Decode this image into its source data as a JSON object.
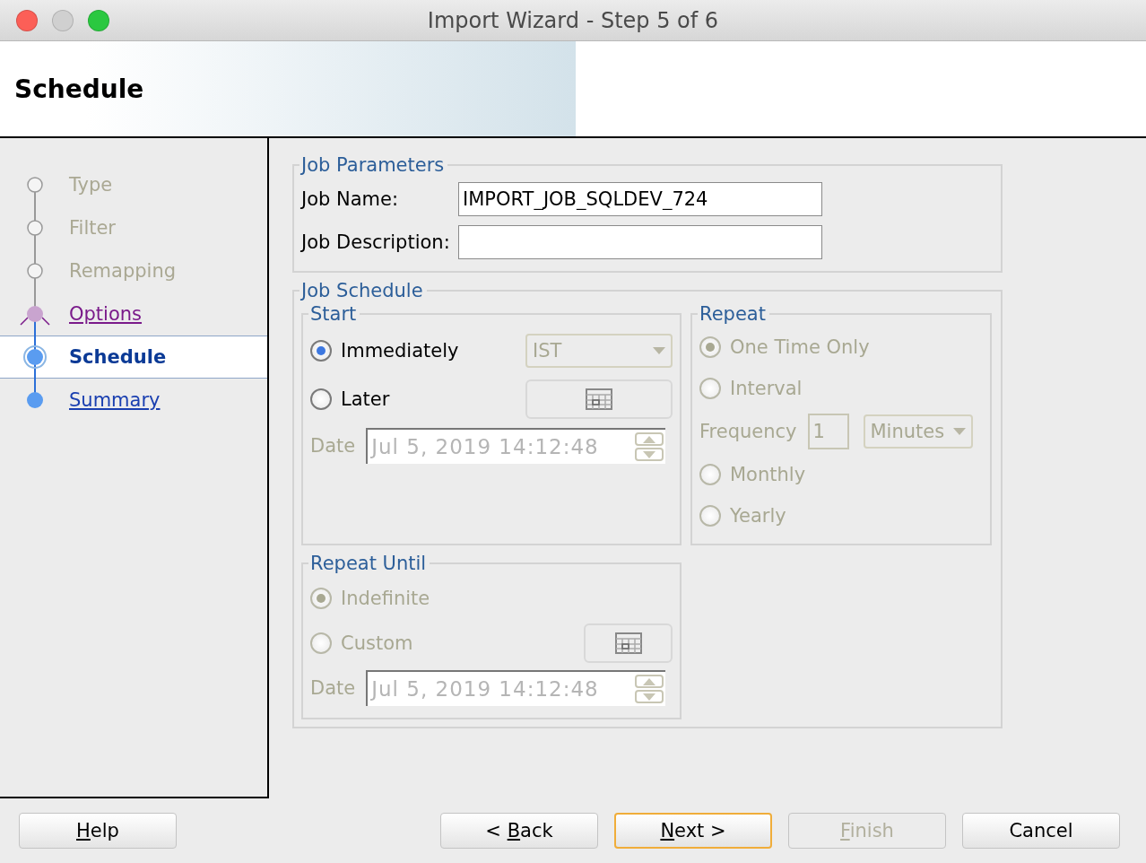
{
  "window": {
    "title": "Import Wizard - Step 5 of 6"
  },
  "header": {
    "title": "Schedule"
  },
  "steps": [
    {
      "label": "Type",
      "kind": "done",
      "selected": false
    },
    {
      "label": "Filter",
      "kind": "done",
      "selected": false
    },
    {
      "label": "Remapping",
      "kind": "done",
      "selected": false
    },
    {
      "label": "Options",
      "kind": "visited",
      "selected": false
    },
    {
      "label": "Schedule",
      "kind": "current",
      "selected": true
    },
    {
      "label": "Summary",
      "kind": "link",
      "selected": false
    }
  ],
  "job_parameters": {
    "title": "Job Parameters",
    "fields": [
      {
        "label": "Job Name:",
        "value": "IMPORT_JOB_SQLDEV_724"
      },
      {
        "label": "Job Description:"
      }
    ]
  },
  "job_schedule": {
    "title": "Job Schedule",
    "start": {
      "title": "Start",
      "options": [
        {
          "label": "Immediately",
          "selected": true,
          "disabled": false
        },
        {
          "label": "Later",
          "selected": false,
          "disabled": false
        }
      ],
      "timezone": {
        "value": "IST",
        "disabled": true
      },
      "date": {
        "label": "Date",
        "value": "Jul 5, 2019 14:12:48",
        "disabled": true
      }
    },
    "repeat": {
      "title": "Repeat",
      "items": [
        {
          "kind": "radio",
          "label": "One Time Only",
          "selected": true,
          "disabled": true
        },
        {
          "kind": "radio",
          "label": "Interval",
          "selected": false,
          "disabled": true
        },
        {
          "kind": "frequency",
          "label": "Frequency",
          "value": "1",
          "unit": "Minutes",
          "disabled": true
        },
        {
          "kind": "radio",
          "label": "Monthly",
          "selected": false,
          "disabled": true
        },
        {
          "kind": "radio",
          "label": "Yearly",
          "selected": false,
          "disabled": true
        }
      ]
    },
    "repeat_until": {
      "title": "Repeat Until",
      "options": [
        {
          "label": "Indefinite",
          "selected": true,
          "disabled": true
        },
        {
          "label": "Custom",
          "selected": false,
          "disabled": true
        }
      ],
      "date": {
        "label": "Date",
        "value": "Jul 5, 2019 14:12:48",
        "disabled": true
      }
    }
  },
  "buttons": [
    {
      "key": "H",
      "after": "elp",
      "disabled": false,
      "default": false
    },
    {
      "before": "< ",
      "key": "B",
      "after": "ack",
      "disabled": false,
      "default": false
    },
    {
      "key": "N",
      "after": "ext >",
      "disabled": false,
      "default": true
    },
    {
      "key": "F",
      "after": "inish",
      "disabled": true,
      "default": false
    },
    {
      "before": "Cancel",
      "disabled": false,
      "default": false
    }
  ]
}
